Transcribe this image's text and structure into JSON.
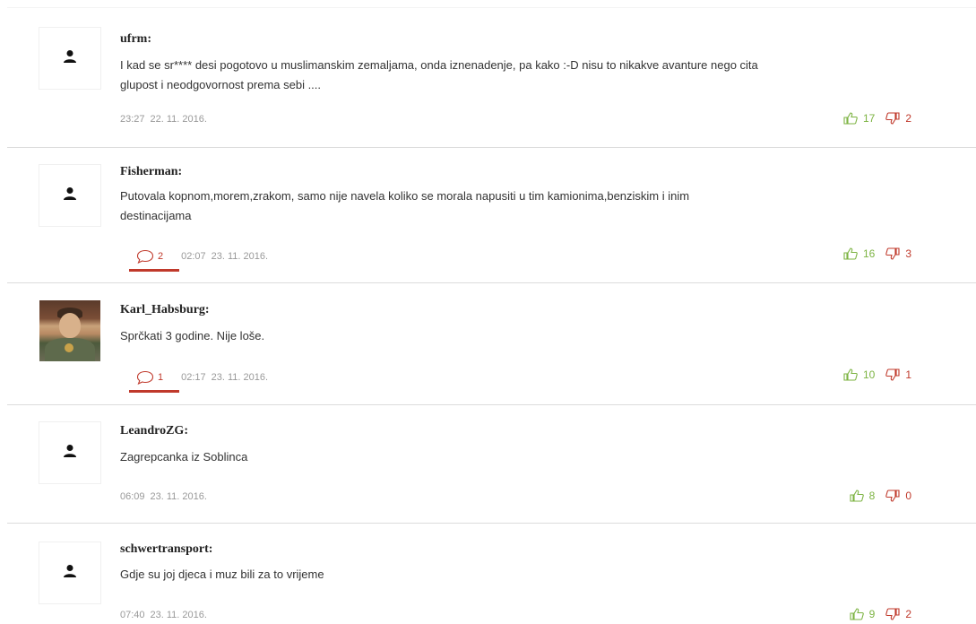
{
  "comments": [
    {
      "author": "ufrm:",
      "text_line1": "I kad se sr**** desi pogotovo u muslimanskim zemaljama, onda iznenadenje, pa kako :-D nisu to nikakve avanture nego cita",
      "text_line2": "glupost i neodgovornost prema sebi ....",
      "time": "23:27",
      "date": "22. 11. 2016.",
      "likes": "17",
      "dislikes": "2"
    },
    {
      "author": "Fisherman:",
      "text_line1": "Putovala kopnom,morem,zrakom, samo nije navela koliko se morala napusiti u tim kamionima,benziskim i inim",
      "text_line2": "destinacijama",
      "replies": "2",
      "time": "02:07",
      "date": "23. 11. 2016.",
      "likes": "16",
      "dislikes": "3"
    },
    {
      "author": "Karl_Habsburg:",
      "text_line1": "Sprčkati 3 godine. Nije loše.",
      "replies": "1",
      "time": "02:17",
      "date": "23. 11. 2016.",
      "likes": "10",
      "dislikes": "1"
    },
    {
      "author": "LeandroZG:",
      "text_line1": "Zagrepcanka iz Soblinca",
      "time": "06:09",
      "date": "23. 11. 2016.",
      "likes": "8",
      "dislikes": "0"
    },
    {
      "author": "schwertransport:",
      "text_line1": "Gdje su joj djeca i muz bili za to vrijeme",
      "time": "07:40",
      "date": "23. 11. 2016.",
      "likes": "9",
      "dislikes": "2"
    }
  ],
  "colors": {
    "like": "#7cb342",
    "dislike": "#c0392b",
    "accent": "#c0392b",
    "meta": "#999999"
  },
  "icons": {
    "avatar_placeholder": "person-icon",
    "reply": "speech-bubble-icon",
    "like": "thumbs-up-icon",
    "dislike": "thumbs-down-icon"
  }
}
